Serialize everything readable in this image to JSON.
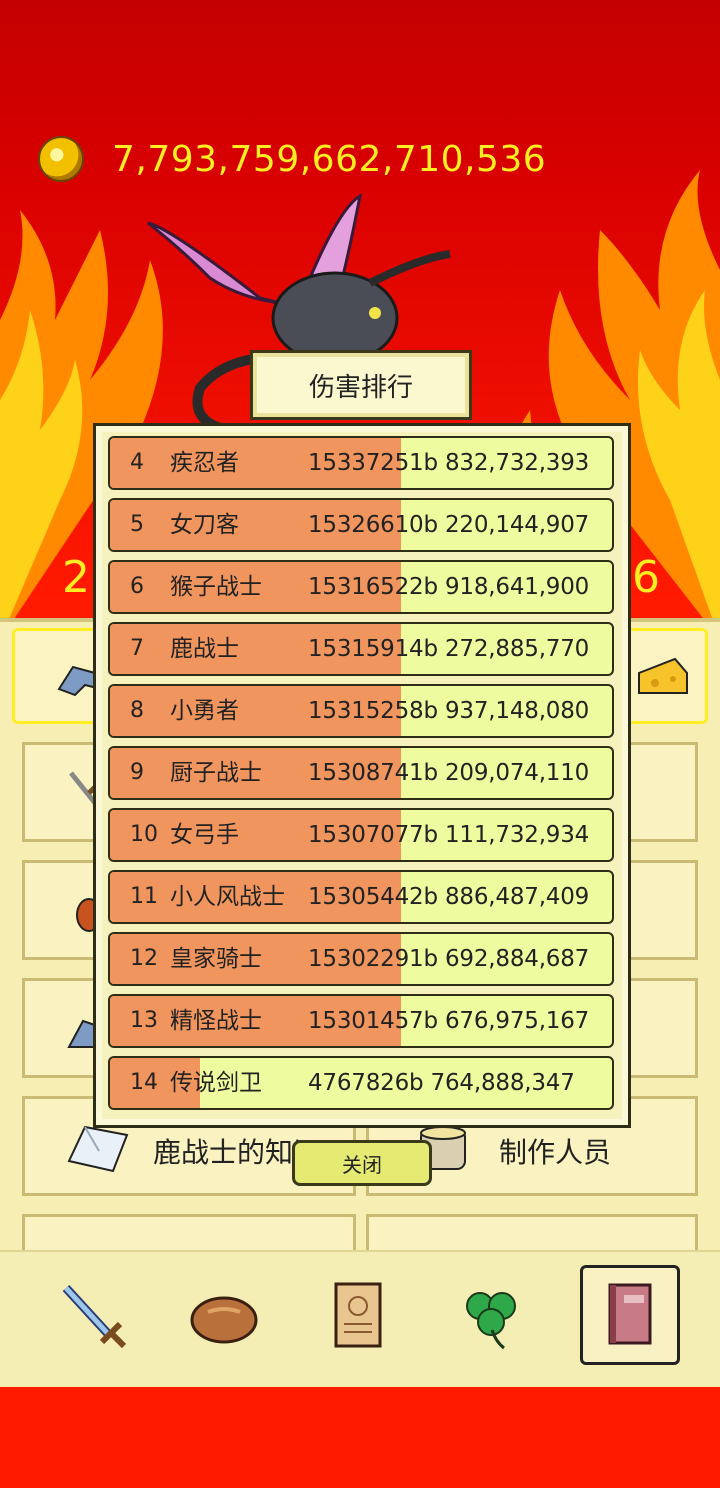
{
  "game": {
    "coins": "7,793,759,662,710,536",
    "dps_left": "2,",
    "dps_right": "6"
  },
  "menu": {
    "cards": [
      {
        "label": "鹿战士的知识"
      },
      {
        "label": "制作人员"
      }
    ]
  },
  "bottom_nav": [
    {
      "icon": "sword-icon"
    },
    {
      "icon": "bread-icon"
    },
    {
      "icon": "scroll-icon"
    },
    {
      "icon": "clover-icon"
    },
    {
      "icon": "book-icon"
    }
  ],
  "ranking": {
    "title": "伤害排行",
    "close_label": "关闭",
    "rows": [
      {
        "rank": "4",
        "name": "疾忍者",
        "score": "15337251b 832,732,393",
        "bar": 0.58
      },
      {
        "rank": "5",
        "name": "女刀客",
        "score": "15326610b 220,144,907",
        "bar": 0.58
      },
      {
        "rank": "6",
        "name": "猴子战士",
        "score": "15316522b 918,641,900",
        "bar": 0.58
      },
      {
        "rank": "7",
        "name": "鹿战士",
        "score": "15315914b 272,885,770",
        "bar": 0.58
      },
      {
        "rank": "8",
        "name": "小勇者",
        "score": "15315258b 937,148,080",
        "bar": 0.58
      },
      {
        "rank": "9",
        "name": "厨子战士",
        "score": "15308741b 209,074,110",
        "bar": 0.58
      },
      {
        "rank": "10",
        "name": "女弓手",
        "score": "15307077b 111,732,934",
        "bar": 0.58
      },
      {
        "rank": "11",
        "name": "小人风战士",
        "score": "15305442b 886,487,409",
        "bar": 0.58
      },
      {
        "rank": "12",
        "name": "皇家骑士",
        "score": "15302291b 692,884,687",
        "bar": 0.58
      },
      {
        "rank": "13",
        "name": "精怪战士",
        "score": "15301457b 676,975,167",
        "bar": 0.58
      },
      {
        "rank": "14",
        "name": "传说剑卫",
        "score": "4767826b 764,888,347",
        "bar": 0.18
      }
    ]
  }
}
